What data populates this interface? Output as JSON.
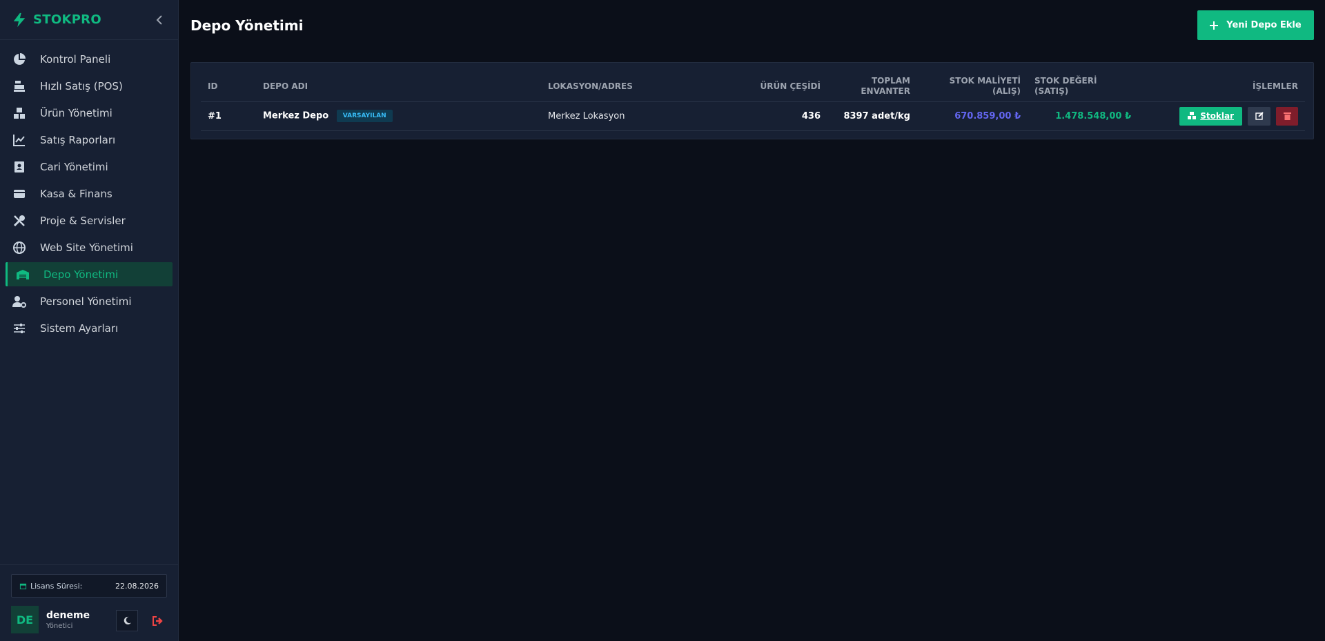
{
  "brand": {
    "name": "STOKPRO",
    "accent": "#10b981"
  },
  "sidebar": {
    "items": [
      {
        "label": "Kontrol Paneli",
        "icon": "pie-chart-icon"
      },
      {
        "label": "Hızlı Satış (POS)",
        "icon": "cash-register-icon"
      },
      {
        "label": "Ürün Yönetimi",
        "icon": "boxes-icon"
      },
      {
        "label": "Satış Raporları",
        "icon": "line-chart-icon"
      },
      {
        "label": "Cari Yönetimi",
        "icon": "contact-card-icon"
      },
      {
        "label": "Kasa & Finans",
        "icon": "wallet-icon"
      },
      {
        "label": "Proje & Servisler",
        "icon": "tools-icon"
      },
      {
        "label": "Web Site Yönetimi",
        "icon": "globe-icon"
      },
      {
        "label": "Depo Yönetimi",
        "icon": "warehouse-icon",
        "active": true
      },
      {
        "label": "Personel Yönetimi",
        "icon": "user-gear-icon"
      },
      {
        "label": "Sistem Ayarları",
        "icon": "sliders-icon"
      }
    ],
    "license": {
      "label": "Lisans Süresi:",
      "date": "22.08.2026"
    },
    "user": {
      "initials": "DE",
      "name": "deneme",
      "role": "Yönetici"
    }
  },
  "main": {
    "title": "Depo Yönetimi",
    "add_button": "Yeni Depo Ekle",
    "table": {
      "headers": {
        "id": "ID",
        "name": "DEPO ADI",
        "location": "LOKASYON/ADRES",
        "variety": "ÜRÜN ÇEŞİDİ",
        "inventory_1": "TOPLAM",
        "inventory_2": "ENVANTER",
        "cost_1": "STOK MALİYETİ",
        "cost_2": "(ALIŞ)",
        "value": "STOK DEĞERİ (SATIŞ)",
        "actions": "İŞLEMLER"
      },
      "rows": [
        {
          "id": "#1",
          "name": "Merkez Depo",
          "badge": "VARSAYILAN",
          "location": "Merkez Lokasyon",
          "variety": "436",
          "inventory": "8397 adet/kg",
          "cost": "670.859,00 ₺",
          "value": "1.478.548,00 ₺",
          "stock_button": "Stoklar"
        }
      ]
    }
  },
  "colors": {
    "cost": "#6366f1",
    "value": "#10b981",
    "delete": "#7f1d2b"
  }
}
